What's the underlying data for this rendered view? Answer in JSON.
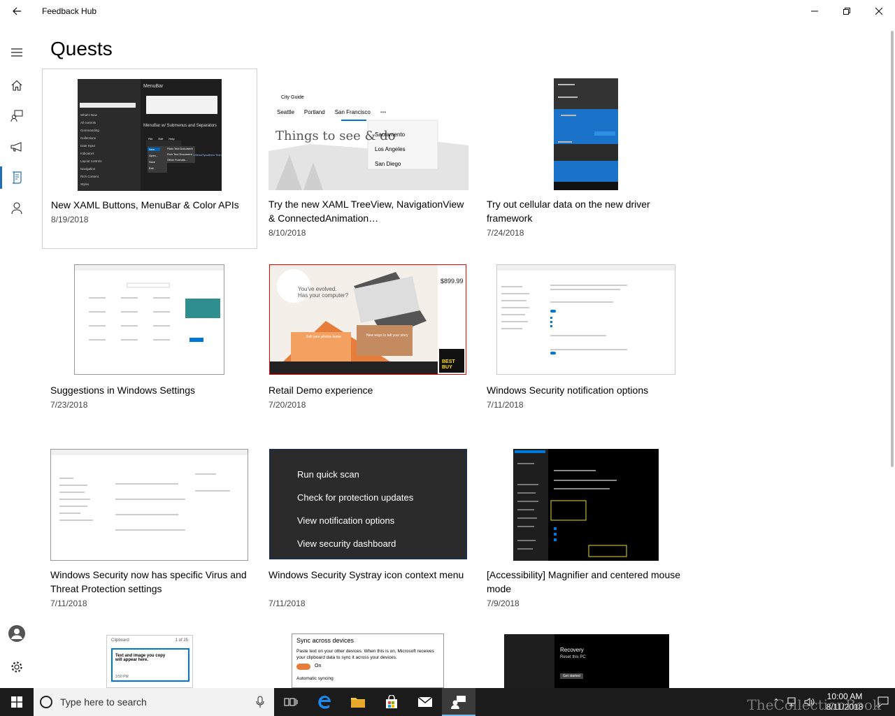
{
  "window": {
    "title": "Feedback Hub"
  },
  "page": {
    "title": "Quests"
  },
  "colors": {
    "accent": "#1f6fb5",
    "taskbar": "#1b1b1b"
  },
  "nav": [
    {
      "name": "menu",
      "icon": "hamburger-icon"
    },
    {
      "name": "home",
      "icon": "home-icon"
    },
    {
      "name": "feedback",
      "icon": "feedback-icon"
    },
    {
      "name": "announcements",
      "icon": "megaphone-icon"
    },
    {
      "name": "quests",
      "icon": "quests-icon",
      "selected": true
    },
    {
      "name": "achievements",
      "icon": "person-icon"
    }
  ],
  "quests": [
    {
      "title": "New XAML Buttons, MenuBar & Color APIs",
      "date": "8/19/2018"
    },
    {
      "title": "Try the new XAML TreeView, NavigationView & ConnectedAnimation…",
      "date": "8/10/2018"
    },
    {
      "title": "Try out cellular data on the new driver framework",
      "date": "7/24/2018"
    },
    {
      "title": "Suggestions in Windows Settings",
      "date": "7/23/2018"
    },
    {
      "title": "Retail Demo experience",
      "date": "7/20/2018"
    },
    {
      "title": "Windows Security notification options",
      "date": "7/11/2018"
    },
    {
      "title": "Windows Security now has specific Virus and Threat Protection settings",
      "date": "7/11/2018"
    },
    {
      "title": "Windows Security Systray icon context menu",
      "date": "7/11/2018"
    },
    {
      "title": " [Accessibility] Magnifier and centered mouse mode",
      "date": "7/9/2018"
    }
  ],
  "thumbs": {
    "menubar": {
      "title": "MenuBar",
      "subtitle": "MenuBar w/ Submenus and Separators",
      "items": [
        "What's New",
        "All controls",
        "Commanding",
        "Collections",
        "Date Input",
        "Indicators",
        "Layout controls",
        "Navigation",
        "Rich Content",
        "Styles"
      ],
      "menu": [
        "File",
        "Edit",
        "Help"
      ],
      "submenu": [
        "New",
        "Open...",
        "Save",
        "Exit"
      ],
      "flyout": [
        "Plain Text Document",
        "Rich Text Document",
        "Other Formats..."
      ]
    },
    "cityguide": {
      "app": "City Guide",
      "tabs": [
        "Seattle",
        "Portland",
        "San Francisco"
      ],
      "more": "•••",
      "headline": "Things to see & do",
      "dropdown": [
        "Sacramento",
        "Los Angeles",
        "San Diego"
      ]
    },
    "systray": {
      "scan": "Run quick scan",
      "updates": "Check for protection updates",
      "notifications": "View notification options",
      "dashboard": "View security dashboard"
    },
    "retail": {
      "line1": "You've evolved.",
      "line2": "Has your computer?",
      "price": "$899.99",
      "photos": "Edit your photos faster",
      "story": "New ways to tell your story"
    },
    "bottom": {
      "clipboard": {
        "title": "Clipboard",
        "count": "1 of 25",
        "text": "Text and image you copy will appear here.",
        "time": "3:50 PM"
      },
      "sync": {
        "title": "Sync across devices",
        "body": "Paste text on your other devices. When this is on, Microsoft receives your clipboard data to sync it across your devices.",
        "toggle": "On",
        "auto": "Automatic syncing"
      },
      "recovery": {
        "title": "Recovery",
        "subtitle": "Reset this PC",
        "button": "Get started"
      }
    }
  },
  "taskbar": {
    "search_placeholder": "Type here to search",
    "time": "10:00 AM",
    "date": "8/11/2018",
    "watermark": "TheCollectionBook"
  }
}
